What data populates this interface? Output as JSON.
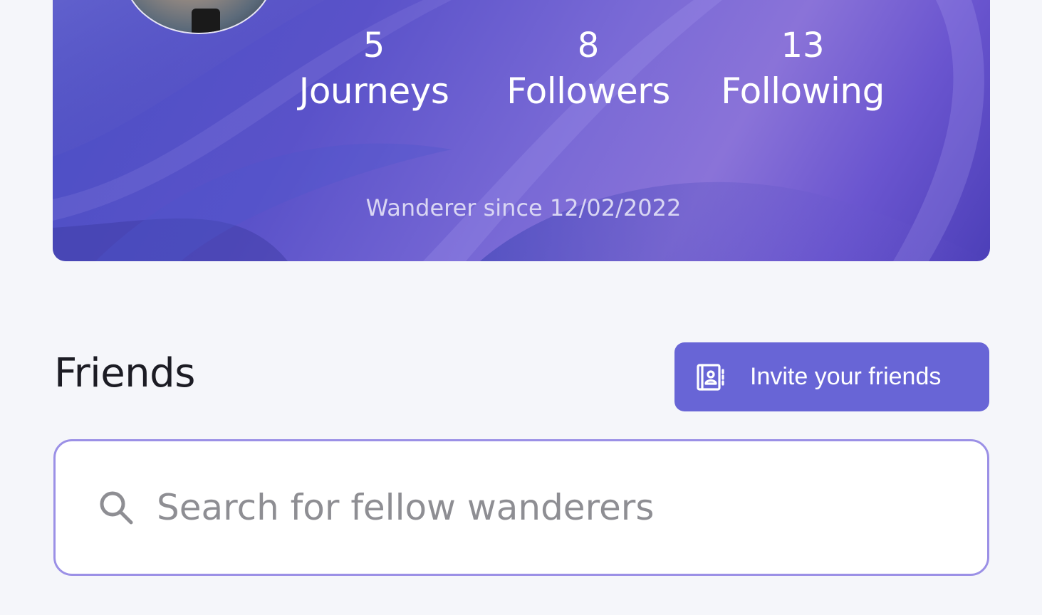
{
  "profile": {
    "stats": [
      {
        "value": "5",
        "label": "Journeys"
      },
      {
        "value": "8",
        "label": "Followers"
      },
      {
        "value": "13",
        "label": "Following"
      }
    ],
    "member_since": "Wanderer since 12/02/2022"
  },
  "friends": {
    "title": "Friends",
    "invite_label": "Invite your friends",
    "invite_icon": "contacts-book-icon"
  },
  "search": {
    "placeholder": "Search for fellow wanderers",
    "value": "",
    "icon": "search-icon"
  },
  "colors": {
    "accent": "#6865d6",
    "search_border": "#9b90e6",
    "card_gradient_start": "#4a4fc4",
    "card_gradient_end": "#8a73d8"
  }
}
